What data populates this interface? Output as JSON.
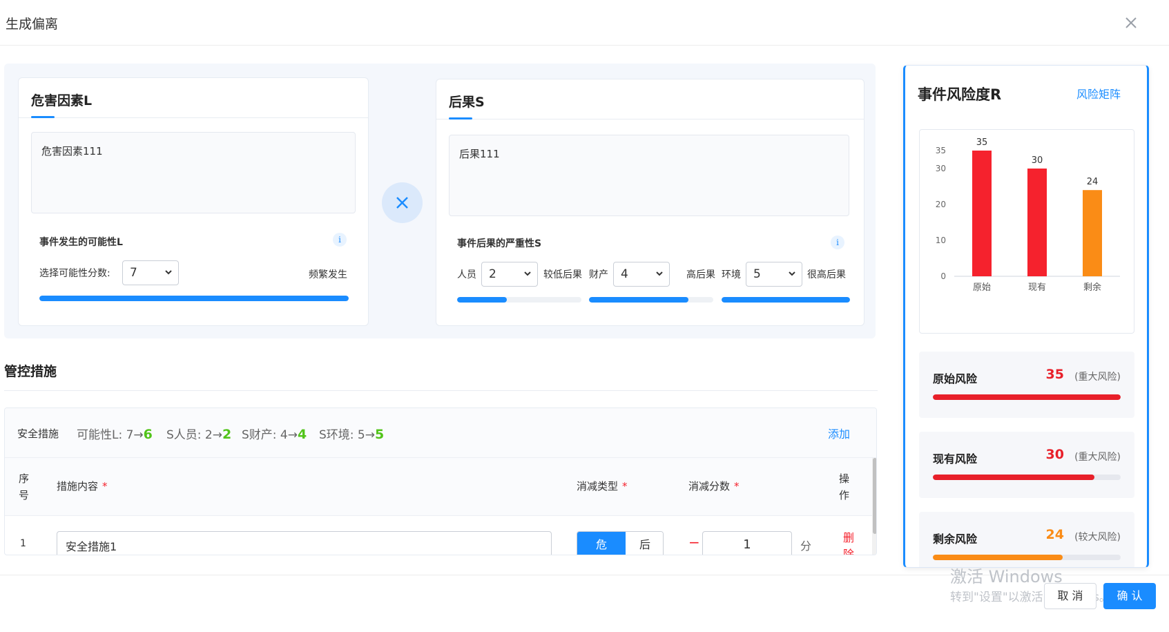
{
  "dialog": {
    "title": "生成偏离"
  },
  "hazard": {
    "title": "危害因素L",
    "text": "危害因素111",
    "likelihood_label": "事件发生的可能性L",
    "info": "i",
    "select_label": "选择可能性分数:",
    "select_value": "7",
    "descriptor": "频繁发生",
    "progress": 1.0
  },
  "multiply_symbol": "×",
  "consequence": {
    "title": "后果S",
    "text": "后果111",
    "severity_label": "事件后果的严重性S",
    "info": "i",
    "groups": [
      {
        "label": "人员",
        "value": "2",
        "descriptor": "较低后果",
        "progress": 0.4
      },
      {
        "label": "财产",
        "value": "4",
        "descriptor": "高后果",
        "progress": 0.8
      },
      {
        "label": "环境",
        "value": "5",
        "descriptor": "很高后果",
        "progress": 1.0
      }
    ]
  },
  "controls": {
    "title": "管控措施",
    "bar_label": "安全措施",
    "summary": [
      {
        "text": "可能性L: 7→",
        "new": "6"
      },
      {
        "text": "S人员: 2→",
        "new": "2"
      },
      {
        "text": "S财产: 4→",
        "new": "4"
      },
      {
        "text": "S环境: 5→",
        "new": "5"
      }
    ],
    "add_label": "添加",
    "columns": {
      "index": "序号",
      "content": "措施内容",
      "type": "消减类型",
      "score": "消减分数",
      "action": "操作"
    },
    "required_mark": "*",
    "rows": [
      {
        "index": "1",
        "content": "安全措施1",
        "type_options": [
          "危",
          "后"
        ],
        "minus": "−",
        "score": "1",
        "unit": "分",
        "delete": "删除"
      }
    ]
  },
  "risk": {
    "title": "事件风险度R",
    "matrix_link": "风险矩阵",
    "items": [
      {
        "label": "原始风险",
        "value": "35",
        "level": "(重大风险)",
        "progress": 1.0,
        "color": "#e8202a"
      },
      {
        "label": "现有风险",
        "value": "30",
        "level": "(重大风险)",
        "progress": 0.86,
        "color": "#e8202a"
      },
      {
        "label": "剩余风险",
        "value": "24",
        "level": "(较大风险)",
        "progress": 0.69,
        "color": "#fa8c16"
      }
    ]
  },
  "chart_data": {
    "type": "bar",
    "categories": [
      "原始",
      "现有",
      "剩余"
    ],
    "values": [
      35,
      30,
      24
    ],
    "colors": [
      "#f5222d",
      "#f5222d",
      "#fa8c16"
    ],
    "yticks": [
      0,
      10,
      20,
      30,
      35
    ],
    "ylim": [
      0,
      35
    ],
    "title": "",
    "xlabel": "",
    "ylabel": ""
  },
  "footer": {
    "cancel": "取 消",
    "confirm": "确 认"
  },
  "watermark": {
    "line1": "激活 Windows",
    "line2": "转到\"设置\"以激活 Windows。"
  }
}
